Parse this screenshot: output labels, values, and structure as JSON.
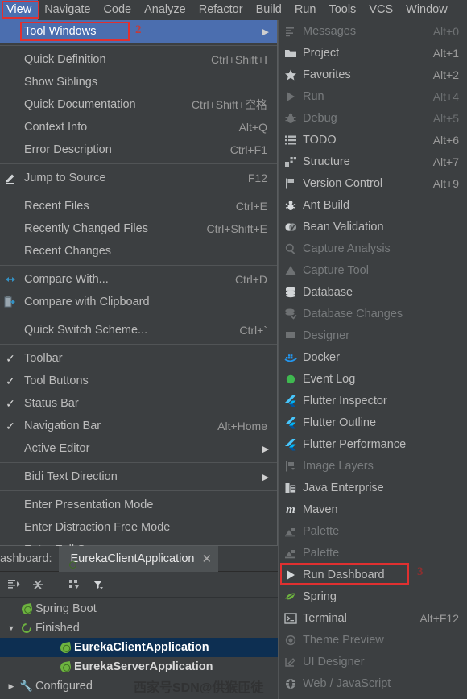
{
  "menubar": {
    "items": [
      {
        "label": "View",
        "accel": "V",
        "active": true
      },
      {
        "label": "Navigate",
        "accel": "N",
        "active": false
      },
      {
        "label": "Code",
        "accel": "C",
        "active": false
      },
      {
        "label": "Analyze",
        "accel": "z",
        "active": false
      },
      {
        "label": "Refactor",
        "accel": "R",
        "active": false
      },
      {
        "label": "Build",
        "accel": "B",
        "active": false
      },
      {
        "label": "Run",
        "accel": "u",
        "active": false
      },
      {
        "label": "Tools",
        "accel": "T",
        "active": false
      },
      {
        "label": "VCS",
        "accel": "S",
        "active": false
      },
      {
        "label": "Window",
        "accel": "W",
        "active": false
      }
    ]
  },
  "view_menu": {
    "marker": "2",
    "items": [
      {
        "label": "Tool Windows",
        "shortcut": "",
        "icon": "",
        "selected": true,
        "submenu": true,
        "check": false,
        "boxed": true
      },
      {
        "type": "separator"
      },
      {
        "label": "Quick Definition",
        "shortcut": "Ctrl+Shift+I",
        "icon": "",
        "check": false
      },
      {
        "label": "Show Siblings",
        "shortcut": "",
        "icon": "",
        "check": false
      },
      {
        "label": "Quick Documentation",
        "shortcut": "Ctrl+Shift+空格",
        "icon": "",
        "check": false
      },
      {
        "label": "Context Info",
        "shortcut": "Alt+Q",
        "icon": "",
        "check": false
      },
      {
        "label": "Error Description",
        "shortcut": "Ctrl+F1",
        "icon": "",
        "check": false
      },
      {
        "type": "separator"
      },
      {
        "label": "Jump to Source",
        "shortcut": "F12",
        "icon": "pencil-icon",
        "check": false
      },
      {
        "type": "separator"
      },
      {
        "label": "Recent Files",
        "shortcut": "Ctrl+E",
        "icon": "",
        "check": false
      },
      {
        "label": "Recently Changed Files",
        "shortcut": "Ctrl+Shift+E",
        "icon": "",
        "check": false
      },
      {
        "label": "Recent Changes",
        "shortcut": "",
        "icon": "",
        "check": false
      },
      {
        "type": "separator"
      },
      {
        "label": "Compare With...",
        "shortcut": "Ctrl+D",
        "icon": "compare-icon",
        "check": false
      },
      {
        "label": "Compare with Clipboard",
        "shortcut": "",
        "icon": "compare-clipboard-icon",
        "check": false
      },
      {
        "type": "separator"
      },
      {
        "label": "Quick Switch Scheme...",
        "shortcut": "Ctrl+`",
        "icon": "",
        "check": false
      },
      {
        "type": "separator"
      },
      {
        "label": "Toolbar",
        "shortcut": "",
        "icon": "",
        "check": true
      },
      {
        "label": "Tool Buttons",
        "shortcut": "",
        "icon": "",
        "check": true
      },
      {
        "label": "Status Bar",
        "shortcut": "",
        "icon": "",
        "check": true
      },
      {
        "label": "Navigation Bar",
        "shortcut": "Alt+Home",
        "icon": "",
        "check": true
      },
      {
        "label": "Active Editor",
        "shortcut": "",
        "icon": "",
        "check": false,
        "submenu": true
      },
      {
        "type": "separator"
      },
      {
        "label": "Bidi Text Direction",
        "shortcut": "",
        "icon": "",
        "check": false,
        "submenu": true
      },
      {
        "type": "separator"
      },
      {
        "label": "Enter Presentation Mode",
        "shortcut": "",
        "icon": "",
        "check": false
      },
      {
        "label": "Enter Distraction Free Mode",
        "shortcut": "",
        "icon": "",
        "check": false
      },
      {
        "label": "Enter Full Screen",
        "shortcut": "",
        "icon": "",
        "check": false
      }
    ]
  },
  "tool_windows_submenu": {
    "marker": "3",
    "items": [
      {
        "label": "Messages",
        "shortcut": "Alt+0",
        "icon": "messages-icon",
        "enabled": false
      },
      {
        "label": "Project",
        "shortcut": "Alt+1",
        "icon": "folder-icon",
        "enabled": true
      },
      {
        "label": "Favorites",
        "shortcut": "Alt+2",
        "icon": "star-icon",
        "enabled": true
      },
      {
        "label": "Run",
        "shortcut": "Alt+4",
        "icon": "play-icon",
        "enabled": false
      },
      {
        "label": "Debug",
        "shortcut": "Alt+5",
        "icon": "bug-icon",
        "enabled": false
      },
      {
        "label": "TODO",
        "shortcut": "Alt+6",
        "icon": "list-icon",
        "enabled": true
      },
      {
        "label": "Structure",
        "shortcut": "Alt+7",
        "icon": "structure-icon",
        "enabled": true
      },
      {
        "label": "Version Control",
        "shortcut": "Alt+9",
        "icon": "branch-icon",
        "enabled": true
      },
      {
        "label": "Ant Build",
        "shortcut": "",
        "icon": "ant-icon",
        "enabled": true
      },
      {
        "label": "Bean Validation",
        "shortcut": "",
        "icon": "bean-icon",
        "enabled": true
      },
      {
        "label": "Capture Analysis",
        "shortcut": "",
        "icon": "search-icon",
        "enabled": false
      },
      {
        "label": "Capture Tool",
        "shortcut": "",
        "icon": "warning-icon",
        "enabled": false
      },
      {
        "label": "Database",
        "shortcut": "",
        "icon": "database-icon",
        "enabled": true
      },
      {
        "label": "Database Changes",
        "shortcut": "",
        "icon": "database-changes-icon",
        "enabled": false
      },
      {
        "label": "Designer",
        "shortcut": "",
        "icon": "designer-icon",
        "enabled": false
      },
      {
        "label": "Docker",
        "shortcut": "",
        "icon": "docker-icon",
        "enabled": true
      },
      {
        "label": "Event Log",
        "shortcut": "",
        "icon": "event-log-icon",
        "enabled": true
      },
      {
        "label": "Flutter Inspector",
        "shortcut": "",
        "icon": "flutter-icon",
        "enabled": true
      },
      {
        "label": "Flutter Outline",
        "shortcut": "",
        "icon": "flutter-icon",
        "enabled": true
      },
      {
        "label": "Flutter Performance",
        "shortcut": "",
        "icon": "flutter-icon",
        "enabled": true
      },
      {
        "label": "Image Layers",
        "shortcut": "",
        "icon": "image-layers-icon",
        "enabled": false
      },
      {
        "label": "Java Enterprise",
        "shortcut": "",
        "icon": "java-enterprise-icon",
        "enabled": true
      },
      {
        "label": "Maven",
        "shortcut": "",
        "icon": "maven-icon",
        "enabled": true
      },
      {
        "label": "Palette",
        "shortcut": "",
        "icon": "palette-icon",
        "enabled": false
      },
      {
        "label": "Palette",
        "shortcut": "",
        "icon": "palette-icon",
        "enabled": false
      },
      {
        "label": "Run Dashboard",
        "shortcut": "",
        "icon": "play-icon",
        "enabled": true,
        "boxed": true
      },
      {
        "label": "Spring",
        "shortcut": "",
        "icon": "spring-icon",
        "enabled": true
      },
      {
        "label": "Terminal",
        "shortcut": "Alt+F12",
        "icon": "terminal-icon",
        "enabled": true
      },
      {
        "label": "Theme Preview",
        "shortcut": "",
        "icon": "theme-preview-icon",
        "enabled": false
      },
      {
        "label": "UI Designer",
        "shortcut": "",
        "icon": "ui-designer-icon",
        "enabled": false
      },
      {
        "label": "Web / JavaScript",
        "shortcut": "",
        "icon": "globe-icon",
        "enabled": false
      }
    ]
  },
  "run_dashboard_panel": {
    "title": "ashboard:",
    "tab": {
      "label": "EurekaClientApplication",
      "close": "✕"
    },
    "toolbar_icons": [
      "expand-all-icon",
      "collapse-all-icon",
      "group-by-icon",
      "filter-icon"
    ],
    "tree": [
      {
        "label": "Spring Boot",
        "icon": "spring-boot-icon",
        "indent": 0,
        "arrow": "",
        "highlight": false,
        "bold": false
      },
      {
        "label": "Finished",
        "icon": "finished-icon",
        "indent": 0,
        "arrow": "▼",
        "highlight": false,
        "bold": false
      },
      {
        "label": "EurekaClientApplication",
        "icon": "spring-boot-icon",
        "indent": 2,
        "arrow": "",
        "highlight": true,
        "bold": true
      },
      {
        "label": "EurekaServerApplication",
        "icon": "spring-boot-icon",
        "indent": 2,
        "arrow": "",
        "highlight": false,
        "bold": true
      },
      {
        "label": "Configured",
        "icon": "wrench-icon",
        "indent": 0,
        "arrow": "▶",
        "highlight": false,
        "bold": false
      }
    ]
  },
  "watermark": {
    "text": "西家号SDN@供猴匝徒"
  },
  "colors": {
    "background": "#3c3f41",
    "selection": "#4b6eaf",
    "annotation_red": "#e03030",
    "tree_selection": "#0d2f52",
    "spring_green": "#6db33f",
    "flutter_blue": "#40bff5"
  }
}
